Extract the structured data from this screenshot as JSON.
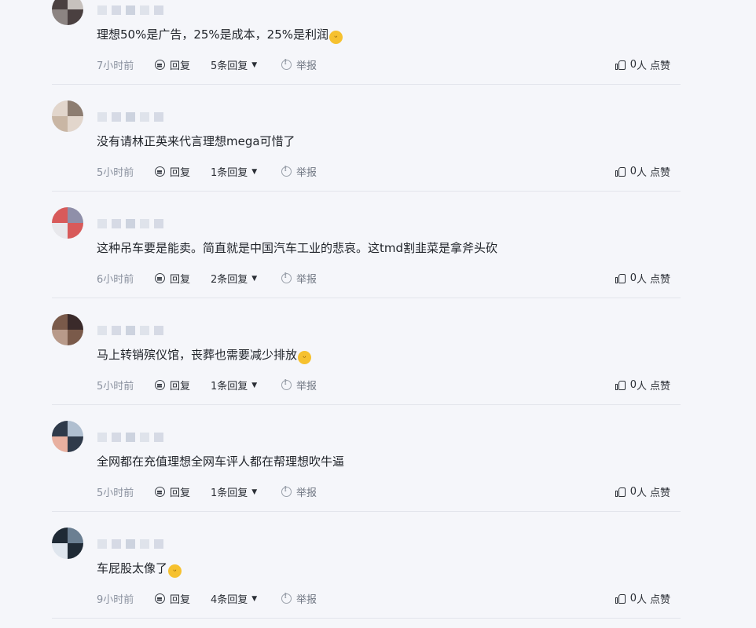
{
  "labels": {
    "reply": "回复",
    "report": "举报",
    "like_unit": "人",
    "like_label": "点赞"
  },
  "comments": [
    {
      "text": "理想50%是广告，25%是成本，25%是利润",
      "emoji": "grin",
      "time": "7小时前",
      "replies": "5条回复",
      "likes": "0"
    },
    {
      "text": "没有请林正英来代言理想mega可惜了",
      "emoji": "",
      "time": "5小时前",
      "replies": "1条回复",
      "likes": "0"
    },
    {
      "text": "这种吊车要是能卖。简直就是中国汽车工业的悲哀。这tmd割韭菜是拿斧头砍",
      "emoji": "",
      "time": "6小时前",
      "replies": "2条回复",
      "likes": "0"
    },
    {
      "text": "马上转销殡仪馆，丧葬也需要减少排放",
      "emoji": "grin",
      "time": "5小时前",
      "replies": "1条回复",
      "likes": "0"
    },
    {
      "text": "全网都在充值理想全网车评人都在帮理想吹牛逼",
      "emoji": "",
      "time": "5小时前",
      "replies": "1条回复",
      "likes": "0"
    },
    {
      "text": "车屁股太像了",
      "emoji": "rofl",
      "time": "9小时前",
      "replies": "4条回复",
      "likes": "0"
    }
  ]
}
